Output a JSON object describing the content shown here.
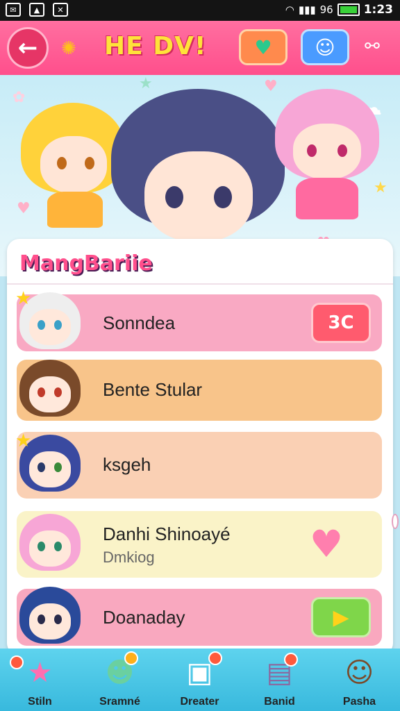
{
  "status_bar": {
    "time": "1:23",
    "battery_text": "96",
    "notification_icons": [
      "mail-icon",
      "photo-icon",
      "block-icon"
    ]
  },
  "header": {
    "title": "HE DV!",
    "back_icon": "arrow-left-icon",
    "favorite_icon": "heart-icon",
    "pet_icon": "cat-face-icon",
    "share_icon": "share-icon"
  },
  "panel": {
    "title": "MangBariie"
  },
  "rows": [
    {
      "name": "Sonndea",
      "badge": "3C",
      "color": "#f9a9c3"
    },
    {
      "name": "Bente Stular",
      "color": "#f8c48a"
    },
    {
      "name": "ksgeh",
      "color": "#fad0b4"
    },
    {
      "name": "Danhi Shinoayé",
      "subtitle": "Dmkiog",
      "color": "#faf3c8"
    },
    {
      "name": "Doanaday",
      "color": "#f9a8bf"
    }
  ],
  "bottom_nav": [
    {
      "label": "Stiln",
      "icon": "star-icon"
    },
    {
      "label": "Sramné",
      "icon": "frog-icon"
    },
    {
      "label": "Dreater",
      "icon": "cube-icon"
    },
    {
      "label": "Banid",
      "icon": "tv-icon"
    },
    {
      "label": "Pasha",
      "icon": "avatar-icon"
    }
  ],
  "colors": {
    "header": "#ff5a94",
    "title_yellow": "#ffe23a",
    "nav_blue": "#4ac6e6",
    "accent_pink": "#ff4f8c"
  }
}
